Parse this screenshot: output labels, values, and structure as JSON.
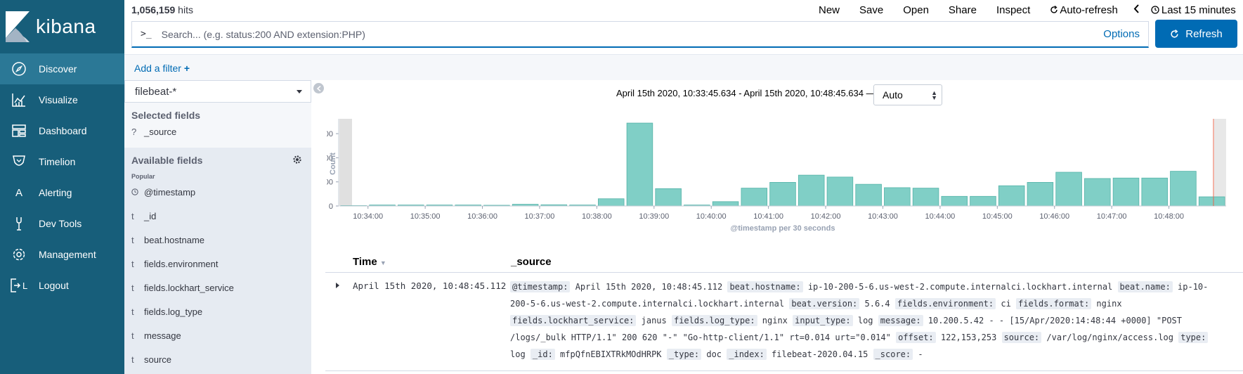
{
  "app": {
    "brand": "kibana"
  },
  "nav": {
    "items": [
      {
        "label": "Discover",
        "icon": "compass-icon",
        "active": true
      },
      {
        "label": "Visualize",
        "icon": "chart-icon"
      },
      {
        "label": "Dashboard",
        "icon": "dashboard-icon"
      },
      {
        "label": "Timelion",
        "icon": "timelion-icon"
      },
      {
        "label": "Alerting",
        "icon": "alerting-icon",
        "glyph": "A"
      },
      {
        "label": "Dev Tools",
        "icon": "wrench-icon"
      },
      {
        "label": "Management",
        "icon": "gear-icon"
      },
      {
        "label": "Logout",
        "icon": "logout-icon"
      }
    ]
  },
  "topbar": {
    "hits_count": "1,056,159",
    "hits_label": " hits",
    "menu": {
      "new": "New",
      "save": "Save",
      "open": "Open",
      "share": "Share",
      "inspect": "Inspect",
      "auto_refresh": "Auto-refresh",
      "time": "Last 15 minutes"
    }
  },
  "search": {
    "prompt": ">_",
    "placeholder": "Search... (e.g. status:200 AND extension:PHP)",
    "value": "",
    "options_label": "Options",
    "refresh_label": "Refresh"
  },
  "filter": {
    "add_label": "Add a filter"
  },
  "fields": {
    "index_pattern": "filebeat-*",
    "selected_header": "Selected fields",
    "selected": [
      {
        "type": "?",
        "name": "_source"
      }
    ],
    "available_header": "Available fields",
    "popular_label": "Popular",
    "available": [
      {
        "type": "clock",
        "name": "@timestamp"
      },
      {
        "type": "t",
        "name": "_id"
      },
      {
        "type": "t",
        "name": "beat.hostname"
      },
      {
        "type": "t",
        "name": "fields.environment"
      },
      {
        "type": "t",
        "name": "fields.lockhart_service"
      },
      {
        "type": "t",
        "name": "fields.log_type"
      },
      {
        "type": "t",
        "name": "message"
      },
      {
        "type": "t",
        "name": "source"
      }
    ]
  },
  "histogram": {
    "range_text": "April 15th 2020, 10:33:45.634 - April 15th 2020, 10:48:45.634 —",
    "interval": "Auto"
  },
  "chart_data": {
    "type": "bar",
    "title": "",
    "xlabel": "@timestamp per 30 seconds",
    "ylabel": "Count",
    "ylim": [
      0,
      175000
    ],
    "yticks": [
      0,
      50000,
      100000,
      150000
    ],
    "ytick_labels": [
      "0",
      "50,000",
      "100,000",
      "150,000"
    ],
    "xtick_labels": [
      "10:34:00",
      "10:35:00",
      "10:36:00",
      "10:37:00",
      "10:38:00",
      "10:39:00",
      "10:40:00",
      "10:41:00",
      "10:42:00",
      "10:43:00",
      "10:44:00",
      "10:45:00",
      "10:46:00",
      "10:47:00",
      "10:48:00"
    ],
    "categories": [
      "10:33:30",
      "10:34:00",
      "10:34:30",
      "10:35:00",
      "10:35:30",
      "10:36:00",
      "10:36:30",
      "10:37:00",
      "10:37:30",
      "10:38:00",
      "10:38:30",
      "10:39:00",
      "10:39:30",
      "10:40:00",
      "10:40:30",
      "10:41:00",
      "10:41:30",
      "10:42:00",
      "10:42:30",
      "10:43:00",
      "10:43:30",
      "10:44:00",
      "10:44:30",
      "10:45:00",
      "10:45:30",
      "10:46:00",
      "10:46:30",
      "10:47:00",
      "10:47:30",
      "10:48:00",
      "10:48:30"
    ],
    "values": [
      800,
      2000,
      2000,
      2000,
      2000,
      1500,
      3500,
      2500,
      2000,
      15000,
      172000,
      36000,
      2000,
      9000,
      37000,
      49000,
      64000,
      60000,
      45000,
      38000,
      37000,
      20000,
      20000,
      42000,
      49000,
      70000,
      57000,
      58000,
      58000,
      72000,
      19000
    ],
    "bar_color": "#80cfc6",
    "bar_stroke": "#54b3a8",
    "shaded_outside_range": true,
    "now_marker_color": "#e7664c",
    "grid": false
  },
  "doc_table": {
    "col_time": "Time",
    "col_source": "_source",
    "rows": [
      {
        "time": "April 15th 2020, 10:48:45.112",
        "source": [
          {
            "k": "@timestamp:",
            "v": "April 15th 2020, 10:48:45.112"
          },
          {
            "k": "beat.hostname:",
            "v": "ip-10-200-5-6.us-west-2.compute.internalci.lockhart.internal"
          },
          {
            "k": "beat.name:",
            "v": "ip-10-200-5-6.us-west-2.compute.internalci.lockhart.internal"
          },
          {
            "k": "beat.version:",
            "v": "5.6.4"
          },
          {
            "k": "fields.environment:",
            "v": "ci"
          },
          {
            "k": "fields.format:",
            "v": "nginx"
          },
          {
            "k": "fields.lockhart_service:",
            "v": "janus"
          },
          {
            "k": "fields.log_type:",
            "v": "nginx"
          },
          {
            "k": "input_type:",
            "v": "log"
          },
          {
            "k": "message:",
            "v": "10.200.5.42 - - [15/Apr/2020:14:48:44 +0000] \"POST /logs/_bulk HTTP/1.1\" 200 620 \"-\" \"Go-http-client/1.1\" rt=0.014 urt=\"0.014\""
          },
          {
            "k": "offset:",
            "v": "122,153,253"
          },
          {
            "k": "source:",
            "v": "/var/log/nginx/access.log"
          },
          {
            "k": "type:",
            "v": "log"
          },
          {
            "k": "_id:",
            "v": "mfpQfnEBIXTRkMOdHRPK"
          },
          {
            "k": "_type:",
            "v": "doc"
          },
          {
            "k": "_index:",
            "v": "filebeat-2020.04.15"
          },
          {
            "k": "_score:",
            "v": "-"
          }
        ]
      }
    ]
  }
}
